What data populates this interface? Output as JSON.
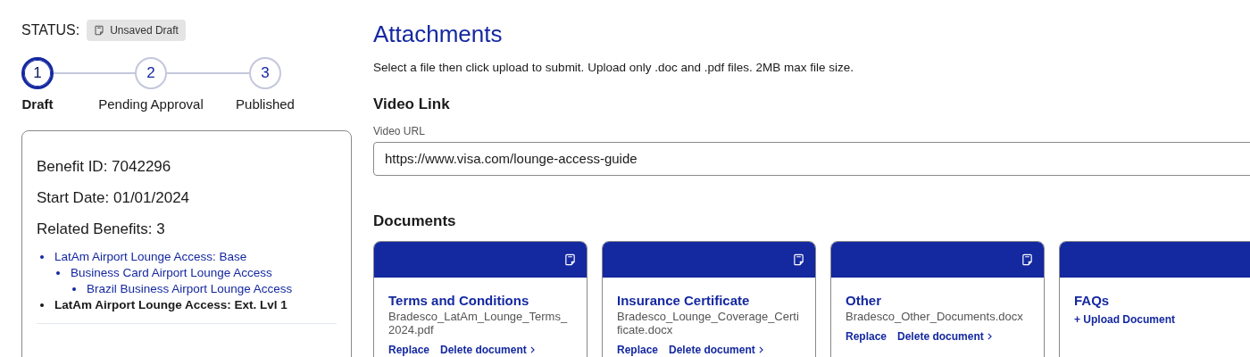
{
  "status": {
    "label": "STATUS:",
    "badge": "Unsaved Draft"
  },
  "steps": [
    {
      "number": "1",
      "label": "Draft",
      "selected": true
    },
    {
      "number": "2",
      "label": "Pending Approval",
      "selected": false
    },
    {
      "number": "3",
      "label": "Published",
      "selected": false
    }
  ],
  "summary": {
    "benefit_id": "Benefit ID: 7042296",
    "start_date": "Start Date: 01/01/2024",
    "related_benefits": "Related Benefits: 3",
    "tree": [
      {
        "label": "LatAm Airport Lounge Access: Base",
        "current": false,
        "children": [
          {
            "label": "Business Card Airport Lounge Access",
            "current": false,
            "children": [
              {
                "label": "Brazil Business Airport Lounge Access",
                "current": false
              }
            ]
          }
        ]
      },
      {
        "label": "LatAm Airport Lounge Access: Ext. Lvl 1",
        "current": true
      }
    ]
  },
  "attachments": {
    "title": "Attachments",
    "instructions": "Select a file then click upload to submit. Upload only .doc and .pdf files. 2MB max file size.",
    "video_heading": "Video Link",
    "video_url": {
      "label": "Video URL",
      "value": "https://www.visa.com/lounge-access-guide"
    },
    "documents_heading": "Documents",
    "documents": [
      {
        "kind": "uploaded",
        "title": "Terms and Conditions",
        "file": "Bradesco_LatAm_Lounge_Terms_2024.pdf",
        "replace": "Replace",
        "delete": "Delete document"
      },
      {
        "kind": "uploaded",
        "title": "Insurance Certificate",
        "file": "Bradesco_Lounge_Coverage_Certificate.docx",
        "replace": "Replace",
        "delete": "Delete document"
      },
      {
        "kind": "uploaded",
        "title": "Other",
        "file": "Bradesco_Other_Documents.docx",
        "replace": "Replace",
        "delete": "Delete document"
      },
      {
        "kind": "empty",
        "title": "FAQs",
        "upload": "+ Upload Document"
      }
    ]
  }
}
